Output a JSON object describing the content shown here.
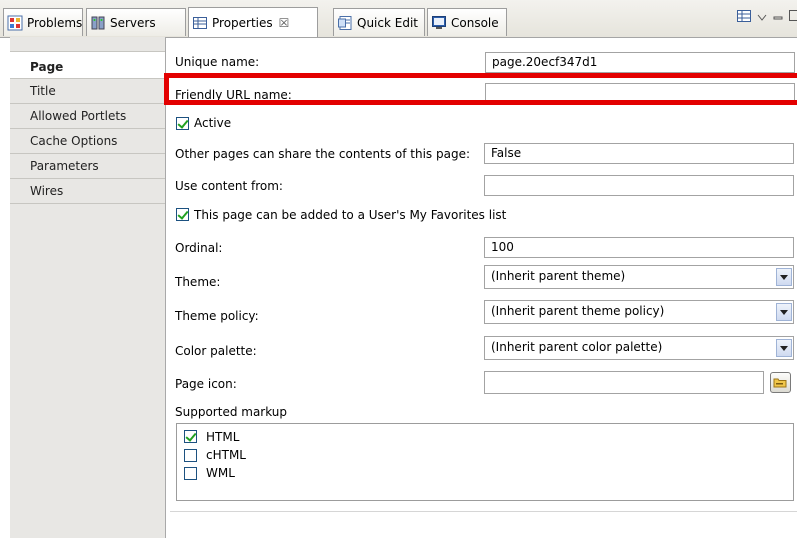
{
  "tabs": [
    {
      "label": "Problems",
      "icon": "problems-icon"
    },
    {
      "label": "Servers",
      "icon": "servers-icon"
    },
    {
      "label": "Properties",
      "icon": "properties-icon",
      "close": "☒"
    },
    {
      "label": "Quick Edit",
      "icon": "quick-edit-icon"
    },
    {
      "label": "Console",
      "icon": "console-icon"
    }
  ],
  "sidebar": {
    "items": [
      {
        "label": "Page"
      },
      {
        "label": "Title"
      },
      {
        "label": "Allowed Portlets"
      },
      {
        "label": "Cache Options"
      },
      {
        "label": "Parameters"
      },
      {
        "label": "Wires"
      }
    ]
  },
  "form": {
    "unique_name": {
      "label": "Unique name:",
      "value": "page.20ecf347d1"
    },
    "friendly_url": {
      "label": "Friendly URL name:",
      "value": ""
    },
    "active": {
      "label": "Active",
      "checked": true
    },
    "share": {
      "label": "Other pages can share the contents of this page:",
      "value": "False"
    },
    "content_from": {
      "label": "Use content from:",
      "value": ""
    },
    "favorites": {
      "label": "This page can be added to a User's My Favorites list",
      "checked": true
    },
    "ordinal": {
      "label": "Ordinal:",
      "value": "100"
    },
    "theme": {
      "label": "Theme:",
      "value": "(Inherit parent theme)"
    },
    "theme_policy": {
      "label": "Theme policy:",
      "value": "(Inherit parent theme policy)"
    },
    "color_palette": {
      "label": "Color palette:",
      "value": "(Inherit parent color palette)"
    },
    "page_icon": {
      "label": "Page icon:",
      "value": ""
    },
    "supported_markup": {
      "label": "Supported markup",
      "options": [
        {
          "label": "HTML",
          "checked": true
        },
        {
          "label": "cHTML",
          "checked": false
        },
        {
          "label": "WML",
          "checked": false
        }
      ]
    }
  },
  "colors": {
    "highlight": "#e30000",
    "sidebar_bg": "#e8e7e4",
    "check_green": "#21a121"
  }
}
